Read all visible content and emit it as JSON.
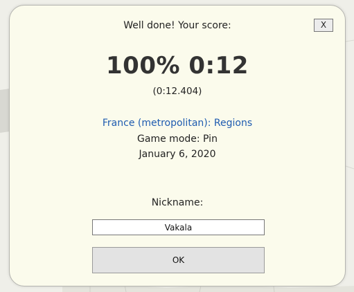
{
  "dialog": {
    "message": "Well done! Your score:",
    "close_label": "X",
    "score": "100% 0:12",
    "precise_time": "(0:12.404)",
    "quiz_title": "France (metropolitan): Regions",
    "game_mode": "Game mode: Pin",
    "date": "January 6, 2020",
    "nickname_label": "Nickname:",
    "nickname_value": "Vakala",
    "ok_label": "OK"
  },
  "colors": {
    "dialog_background": "#fbfbec",
    "quiz_title": "#1e5bb0",
    "ok_button": "#e3e3e3"
  }
}
